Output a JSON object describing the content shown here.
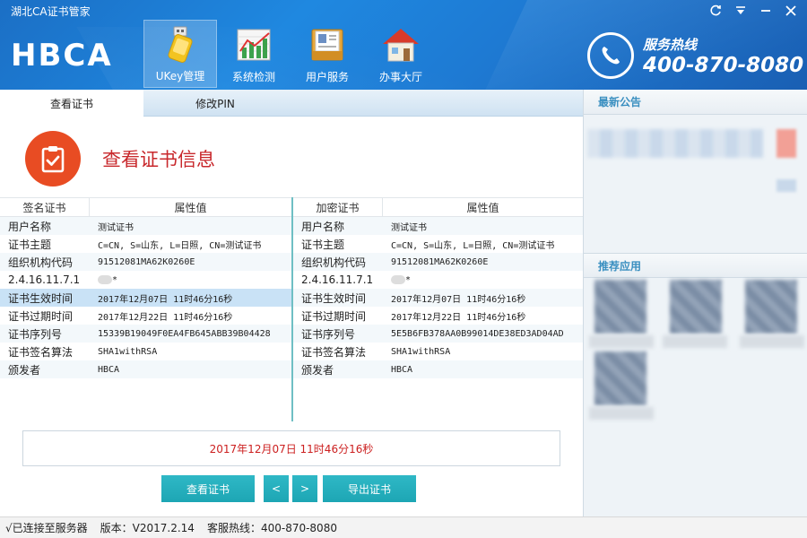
{
  "window": {
    "title": "湖北CA证书管家"
  },
  "brand": {
    "logo": "HBCA"
  },
  "nav": [
    {
      "label": "UKey管理",
      "icon": "usb-key-icon",
      "active": true
    },
    {
      "label": "系统检测",
      "icon": "chart-icon",
      "active": false
    },
    {
      "label": "用户服务",
      "icon": "user-card-icon",
      "active": false
    },
    {
      "label": "办事大厅",
      "icon": "house-icon",
      "active": false
    }
  ],
  "hotline": {
    "label": "服务热线",
    "number": "400-870-8080"
  },
  "tabs": [
    {
      "label": "查看证书",
      "active": true
    },
    {
      "label": "修改PIN",
      "active": false
    }
  ],
  "cert": {
    "title": "查看证书信息",
    "sign": {
      "header": {
        "col1": "签名证书",
        "col2": "属性值"
      },
      "rows": [
        {
          "k": "用户名称",
          "v": "测试证书"
        },
        {
          "k": "证书主题",
          "v": "C=CN, S=山东, L=日照, CN=测试证书"
        },
        {
          "k": "组织机构代码",
          "v": "91512081MA62K0260E"
        },
        {
          "k": "2.4.16.11.7.1",
          "v": "*"
        },
        {
          "k": "证书生效时间",
          "v": "2017年12月07日 11时46分16秒"
        },
        {
          "k": "证书过期时间",
          "v": "2017年12月22日 11时46分16秒"
        },
        {
          "k": "证书序列号",
          "v": "15339B19049F0EA4FB645ABB39B04428"
        },
        {
          "k": "证书签名算法",
          "v": "SHA1withRSA"
        },
        {
          "k": "颁发者",
          "v": "HBCA"
        }
      ]
    },
    "enc": {
      "header": {
        "col1": "加密证书",
        "col2": "属性值"
      },
      "rows": [
        {
          "k": "用户名称",
          "v": "测试证书"
        },
        {
          "k": "证书主题",
          "v": "C=CN, S=山东, L=日照, CN=测试证书"
        },
        {
          "k": "组织机构代码",
          "v": "91512081MA62K0260E"
        },
        {
          "k": "2.4.16.11.7.1",
          "v": "*"
        },
        {
          "k": "证书生效时间",
          "v": "2017年12月07日 11时46分16秒"
        },
        {
          "k": "证书过期时间",
          "v": "2017年12月22日 11时46分16秒"
        },
        {
          "k": "证书序列号",
          "v": "5E5B6FB378AA0B99014DE38ED3AD04AD"
        },
        {
          "k": "证书签名算法",
          "v": "SHA1withRSA"
        },
        {
          "k": "颁发者",
          "v": "HBCA"
        }
      ]
    },
    "selected_value": "2017年12月07日 11时46分16秒"
  },
  "buttons": {
    "view": "查看证书",
    "prev": "<",
    "next": ">",
    "export": "导出证书"
  },
  "status": {
    "connected": "√已连接至服务器",
    "version": "版本：V2017.2.14",
    "hotline": "客服热线：400-870-8080"
  },
  "sidebar": {
    "news_title": "最新公告",
    "apps_title": "推荐应用"
  },
  "colors": {
    "header_blue": "#1f88e0",
    "accent_red": "#c8282c",
    "button_teal": "#1da6b4",
    "badge_orange": "#e84c23"
  }
}
